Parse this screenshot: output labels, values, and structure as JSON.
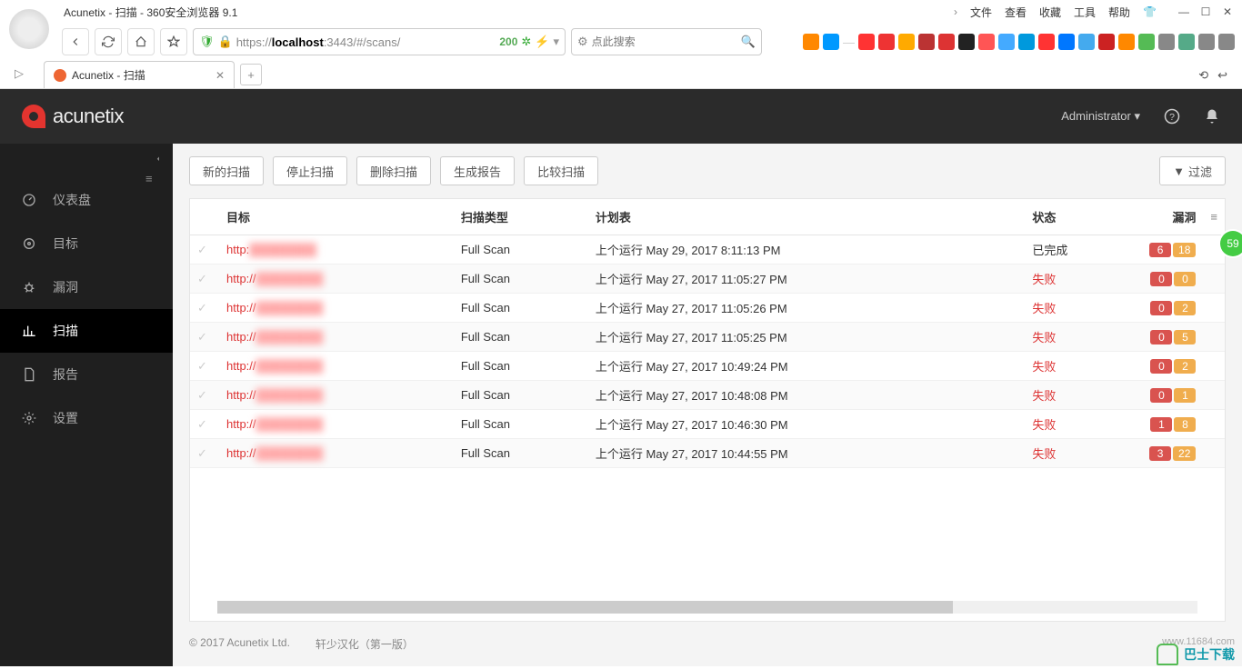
{
  "browser": {
    "title": "Acunetix - 扫描 - 360安全浏览器 9.1",
    "menus": [
      "文件",
      "查看",
      "收藏",
      "工具",
      "帮助"
    ],
    "url_html": "https://<b>localhost</b>:3443/#/scans/",
    "status_code": "200",
    "search_placeholder": "点此搜索",
    "tab_title": "Acunetix - 扫描",
    "score": "59",
    "watermark": "巴士下载",
    "watermark_url": "www.11684.com"
  },
  "header": {
    "brand": "acunetix",
    "user": "Administrator"
  },
  "sidebar": {
    "items": [
      {
        "label": "仪表盘"
      },
      {
        "label": "目标"
      },
      {
        "label": "漏洞"
      },
      {
        "label": "扫描"
      },
      {
        "label": "报告"
      },
      {
        "label": "设置"
      }
    ],
    "active_index": 3
  },
  "toolbar": {
    "new_scan": "新的扫描",
    "stop_scan": "停止扫描",
    "delete_scan": "删除扫描",
    "gen_report": "生成报告",
    "compare": "比较扫描",
    "filter": "过滤"
  },
  "table": {
    "headers": {
      "target": "目标",
      "scan_type": "扫描类型",
      "schedule": "计划表",
      "status": "状态",
      "vuln": "漏洞"
    },
    "schedule_prefix": "上个运行",
    "rows": [
      {
        "target": "http:",
        "scan_type": "Full Scan",
        "time": "May 29, 2017 8:11:13 PM",
        "status": "已完成",
        "status_fail": false,
        "v1": "6",
        "v2": "18"
      },
      {
        "target": "http://",
        "scan_type": "Full Scan",
        "time": "May 27, 2017 11:05:27 PM",
        "status": "失败",
        "status_fail": true,
        "v1": "0",
        "v2": "0"
      },
      {
        "target": "http://",
        "scan_type": "Full Scan",
        "time": "May 27, 2017 11:05:26 PM",
        "status": "失败",
        "status_fail": true,
        "v1": "0",
        "v2": "2"
      },
      {
        "target": "http://",
        "scan_type": "Full Scan",
        "time": "May 27, 2017 11:05:25 PM",
        "status": "失败",
        "status_fail": true,
        "v1": "0",
        "v2": "5"
      },
      {
        "target": "http://",
        "scan_type": "Full Scan",
        "time": "May 27, 2017 10:49:24 PM",
        "status": "失败",
        "status_fail": true,
        "v1": "0",
        "v2": "2"
      },
      {
        "target": "http://",
        "scan_type": "Full Scan",
        "time": "May 27, 2017 10:48:08 PM",
        "status": "失败",
        "status_fail": true,
        "v1": "0",
        "v2": "1"
      },
      {
        "target": "http://",
        "scan_type": "Full Scan",
        "time": "May 27, 2017 10:46:30 PM",
        "status": "失败",
        "status_fail": true,
        "v1": "1",
        "v2": "8"
      },
      {
        "target": "http://",
        "scan_type": "Full Scan",
        "time": "May 27, 2017 10:44:55 PM",
        "status": "失败",
        "status_fail": true,
        "v1": "3",
        "v2": "22"
      }
    ]
  },
  "footer": {
    "copyright": "© 2017 Acunetix Ltd.",
    "credit": "轩少汉化（第一版）"
  },
  "ext_colors": [
    "#f80",
    "#09f",
    "#f33",
    "#e33",
    "#fa0",
    "#b33",
    "#d33",
    "#222",
    "#f55",
    "#4af",
    "#09d",
    "#f33",
    "#07f",
    "#4ae",
    "#c22",
    "#f80",
    "#5b5",
    "#888",
    "#5a8",
    "#888",
    "#888"
  ]
}
